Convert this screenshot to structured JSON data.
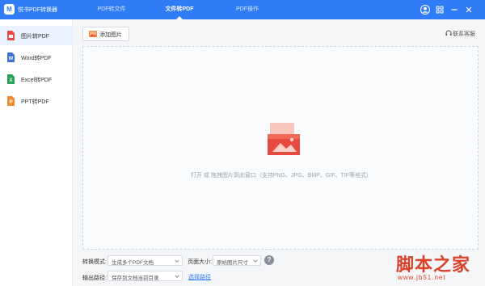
{
  "app": {
    "title": "悦书PDF转换器",
    "logo_letter": "M"
  },
  "tabs": [
    {
      "label": "PDF转文件",
      "active": false
    },
    {
      "label": "文件转PDF",
      "active": true
    },
    {
      "label": "PDF操作",
      "active": false
    }
  ],
  "header_icons": [
    "user-icon",
    "grid-icon",
    "minimize-icon",
    "close-icon"
  ],
  "sidebar": {
    "items": [
      {
        "label": "图片转PDF",
        "active": true,
        "icon": "image-file-icon",
        "color": "#e94a3f"
      },
      {
        "label": "Word转PDF",
        "active": false,
        "icon": "word-file-icon",
        "color": "#3b6fd8"
      },
      {
        "label": "Excel转PDF",
        "active": false,
        "icon": "excel-file-icon",
        "color": "#2aa35a"
      },
      {
        "label": "PPT转PDF",
        "active": false,
        "icon": "ppt-file-icon",
        "color": "#f08a2a"
      }
    ]
  },
  "toolbar": {
    "add_label": "添加图片",
    "support_label": "联系客服"
  },
  "dropzone": {
    "hint": "打开 或 拖拽图片到此窗口（支持PNG、JPG、BMP、GIF、TIF等格式）"
  },
  "settings": {
    "mode_label": "转换模式:",
    "mode_value": "生成多个PDF文档",
    "page_size_label": "页面大小:",
    "page_size_value": "原始图片尺寸",
    "output_label": "输出路径:",
    "output_value": "保存到文档当前目录",
    "choose_path_label": "选择路径"
  },
  "watermark": {
    "text": "脚本之家",
    "url": "www.jb51.net"
  },
  "colors": {
    "brand": "#2f7cf6",
    "accent_red": "#e94a3f"
  }
}
